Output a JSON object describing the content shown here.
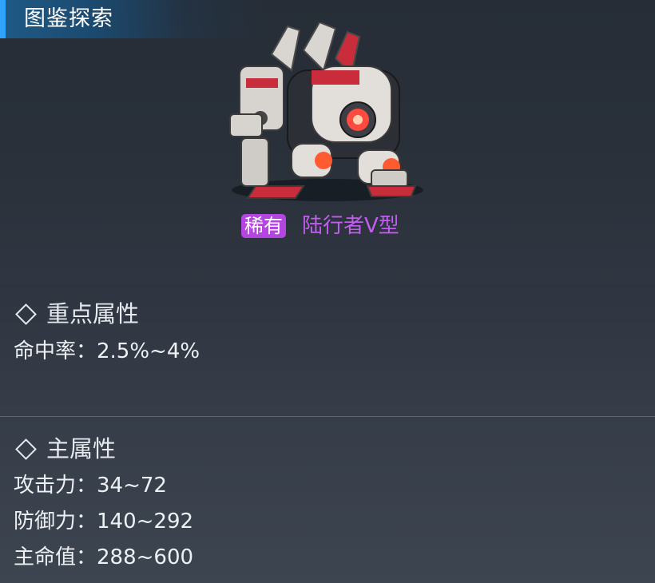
{
  "header": {
    "title": "图鉴探索"
  },
  "unit": {
    "rarity": "稀有",
    "name": "陆行者V型",
    "image": "red-white-mech-walker"
  },
  "colors": {
    "accent": "#2ea4ff",
    "rarity_bg": "#b445e0",
    "name": "#c35cf0"
  },
  "key_attributes": {
    "title": "重点属性",
    "items": [
      {
        "label": "命中率：2.5%~4%"
      }
    ]
  },
  "main_attributes": {
    "title": "主属性",
    "items": [
      {
        "label": "攻击力：34~72"
      },
      {
        "label": "防御力：140~292"
      },
      {
        "label": "主命值：288~600"
      }
    ]
  }
}
